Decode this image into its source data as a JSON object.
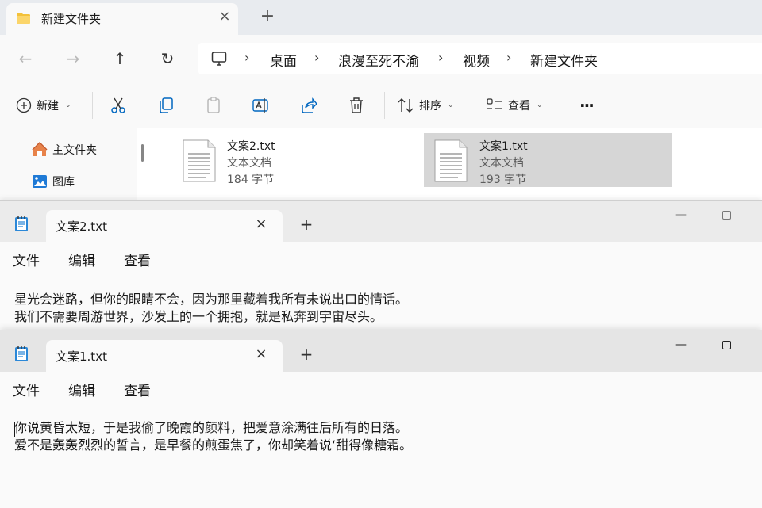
{
  "explorer": {
    "tab_title": "新建文件夹",
    "tab_close": "×",
    "new_tab": "+",
    "nav": {
      "back": "←",
      "forward": "→",
      "up": "↑",
      "refresh": "↻"
    },
    "breadcrumb": [
      "桌面",
      "浪漫至死不渝",
      "视频",
      "新建文件夹"
    ],
    "breadcrumb_sep": "›",
    "toolbar": {
      "new_label": "新建",
      "sort_label": "排序",
      "view_label": "查看",
      "more_label": "···"
    },
    "sidebar": [
      {
        "label": "主文件夹",
        "icon": "home-icon"
      },
      {
        "label": "图库",
        "icon": "gallery-icon"
      }
    ],
    "files": [
      {
        "name": "文案2.txt",
        "type": "文本文档",
        "size": "184 字节",
        "selected": false
      },
      {
        "name": "文案1.txt",
        "type": "文本文档",
        "size": "193 字节",
        "selected": true
      }
    ]
  },
  "notepads": [
    {
      "tab_title": "文案2.txt",
      "menu": [
        "文件",
        "编辑",
        "查看"
      ],
      "lines": [
        "星光会迷路，但你的眼睛不会，因为那里藏着我所有未说出口的情话。",
        "我们不需要周游世界，沙发上的一个拥抱，就是私奔到宇宙尽头。"
      ]
    },
    {
      "tab_title": "文案1.txt",
      "menu": [
        "文件",
        "编辑",
        "查看"
      ],
      "lines": [
        "你说黄昏太短，于是我偷了晚霞的颜料，把爱意涂满往后所有的日落。",
        "爱不是轰轰烈烈的誓言，是早餐的煎蛋焦了，你却笑着说‘甜得像糖霜。"
      ]
    }
  ],
  "common": {
    "close": "×",
    "new_tab": "+",
    "minimize": "—"
  },
  "colors": {
    "accent": "#0067c0",
    "folder": "#f3c13a",
    "notepad_icon": "#2b88d8"
  }
}
